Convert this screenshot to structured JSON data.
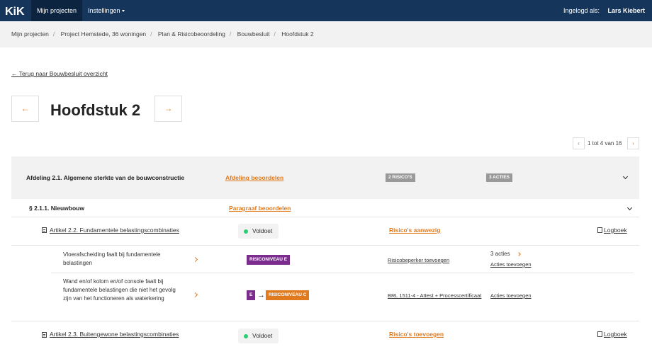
{
  "header": {
    "logo": "KiK",
    "nav_active": "Mijn projecten",
    "nav_settings": "Instellingen",
    "login_label": "Ingelogd als:",
    "login_user": "Lars Kiebert"
  },
  "breadcrumb": [
    "Mijn projecten",
    "Project Hemstede, 36 woningen",
    "Plan & Risicobeoordeling",
    "Bouwbesluit",
    "Hoofdstuk 2"
  ],
  "back_link": "← Terug naar Bouwbesluit overzicht",
  "page_title": "Hoofdstuk 2",
  "pager": {
    "prev": "‹",
    "text": "1 tot 4 van 16",
    "next": "›"
  },
  "prev_arrow": "←",
  "next_arrow": "→",
  "afdeling": {
    "label": "Afdeling 2.1. Algemene sterkte van de bouwconstructie",
    "link": "Afdeling beoordelen",
    "risicos": "2 RISICO'S",
    "acties": "3 ACTIES"
  },
  "paragraaf": {
    "label": "§ 2.1.1. Nieuwbouw",
    "link": "Paragraaf beoordelen"
  },
  "artikelen": [
    {
      "label": "Artikel 2.2. Fundamentele belastingscombinaties",
      "status": "Voldoet",
      "risico_link": "Risico's aanwezig",
      "logboek": "Logboek"
    },
    {
      "label": "Artikel 2.3. Buitengewone belastingscombinaties",
      "status": "Voldoet",
      "risico_link": "Risico's toevoegen",
      "logboek": "Logboek"
    }
  ],
  "risks": [
    {
      "text": "Vloerafscheiding faalt bij fundamentele belastingen",
      "level": "RISICONIVEAU E",
      "maatregel": "Risicobeperker toevoegen",
      "acties_count": "3 acties",
      "acties_link": "Acties toevoegen"
    },
    {
      "text": "Wand en/of kolom en/of console faalt bij fundamentele belastingen die niet het gevolg zijn van het functioneren als waterkering",
      "level_from": "E",
      "arrow": "→",
      "level_to": "RISICONIVEAU C",
      "maatregel": "BRL 1511-4 - Attest + Processcertificaat",
      "acties_link": "Acties toevoegen"
    }
  ],
  "colors": {
    "navy": "#15365a",
    "orange": "#e07a1f",
    "purple": "#7b2d8e",
    "green": "#2ecc71"
  }
}
